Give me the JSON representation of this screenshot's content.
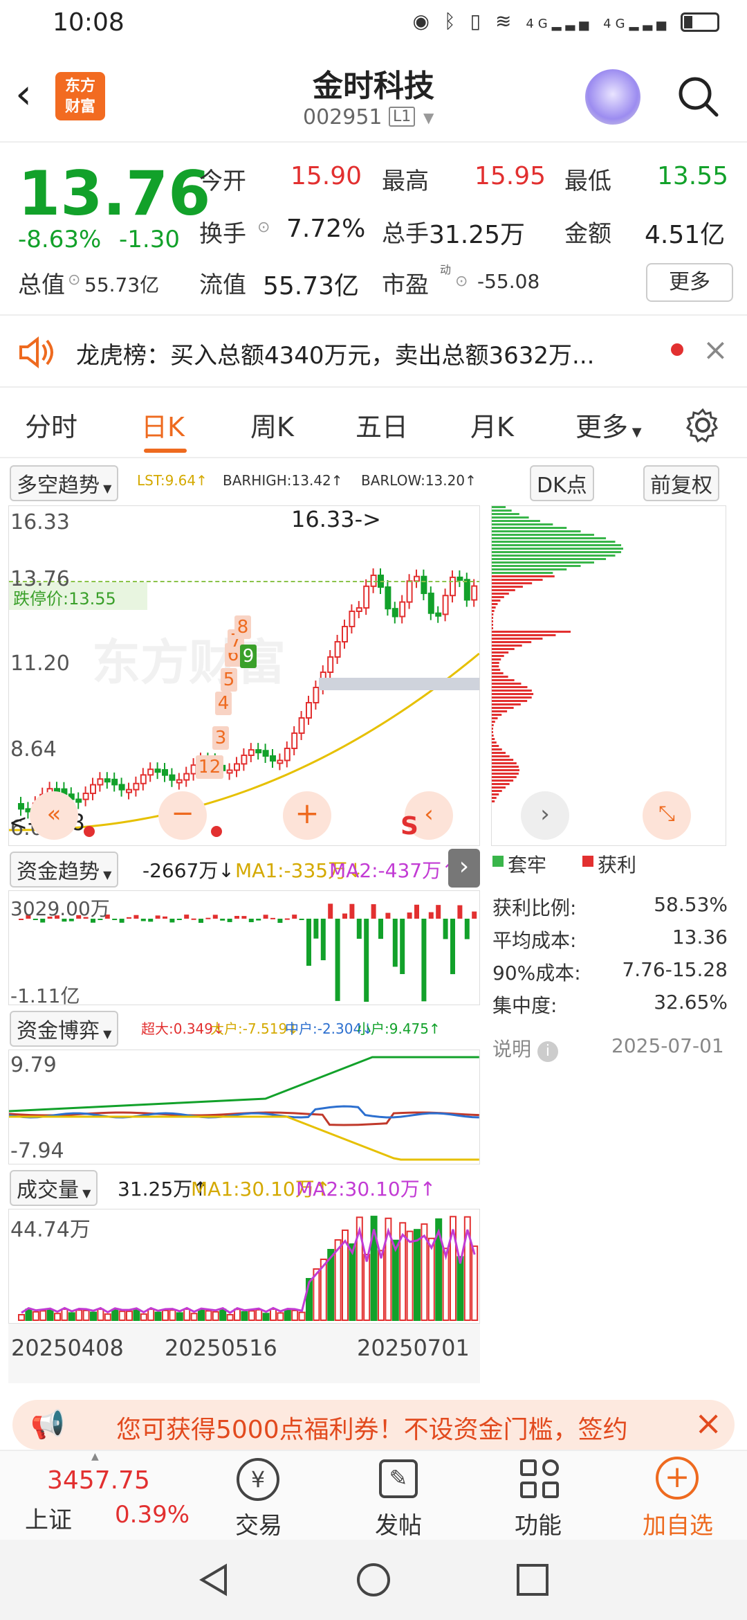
{
  "status": {
    "time": "10:08",
    "network1": "4G",
    "network2": "4G"
  },
  "header": {
    "logo_text": "东方\n财富",
    "title": "金时科技",
    "code": "002951",
    "level": "L1"
  },
  "quote": {
    "price": "13.76",
    "change_pct": "-8.63%",
    "change": "-1.30",
    "open_label": "今开",
    "open": "15.90",
    "high_label": "最高",
    "high": "15.95",
    "low_label": "最低",
    "low": "13.55",
    "turnover_label": "换手",
    "turnover": "7.72%",
    "volume_label": "总手",
    "volume": "31.25万",
    "amount_label": "金额",
    "amount": "4.51亿",
    "mktcap_label": "总值",
    "mktcap": "55.73亿",
    "float_label": "流值",
    "float": "55.73亿",
    "pe_label": "市盈",
    "pe_sup": "动",
    "pe": "-55.08",
    "more": "更多"
  },
  "notice": {
    "text": "龙虎榜：买入总额4340万元，卖出总额3632万..."
  },
  "tabs": [
    "分时",
    "日K",
    "周K",
    "五日",
    "月K",
    "更多"
  ],
  "kline": {
    "indicator": "多空趋势",
    "lst": "LST:9.64↑",
    "barhigh": "BARHIGH:13.42↑",
    "barlow": "BARLOW:13.20↑",
    "dk_btn": "DK点",
    "fq_btn": "前复权",
    "y_labels": [
      "16.33",
      "13.76",
      "11.20",
      "8.64",
      "6.08"
    ],
    "high_mark": "16.33->",
    "low_mark": "<-6.08",
    "limit_label": "跌停价:13.55",
    "seq_nums": [
      "1",
      "2",
      "3",
      "4",
      "5",
      "6",
      "7",
      "8",
      "9"
    ],
    "watermark": "东方财富"
  },
  "fund": {
    "label": "资金趋势",
    "val": "-2667万↓",
    "ma1": "MA1:-335万↓",
    "ma2": "MA2:-437万↑",
    "top": "3029.00万",
    "bottom": "-1.11亿"
  },
  "game": {
    "label": "资金博弈",
    "super": "超大:0.349↓",
    "big": "大户:-7.519↓",
    "mid": "中户:-2.304↓",
    "small": "小户:9.475↑",
    "top": "9.79",
    "bottom": "-7.94"
  },
  "vol": {
    "label": "成交量",
    "val": "31.25万↑",
    "ma1": "MA1:30.10万↑",
    "ma2": "MA2:30.10万↑",
    "top": "44.74万"
  },
  "dates": [
    "20250408",
    "20250516",
    "20250701"
  ],
  "chip": {
    "legend_trap": "套牢",
    "legend_profit": "获利",
    "rows": [
      {
        "k": "获利比例:",
        "v": "58.53%"
      },
      {
        "k": "平均成本:",
        "v": "13.36"
      },
      {
        "k": "90%成本:",
        "v": "7.76-15.28"
      },
      {
        "k": "集中度:",
        "v": "32.65%"
      }
    ],
    "note": "说明",
    "date": "2025-07-01"
  },
  "banner": {
    "text": "您可获得5000点福利券！不设资金门槛，签约"
  },
  "bottom": {
    "index_value": "3457.75",
    "index_name": "上证",
    "index_pct": "0.39%",
    "trade": "交易",
    "post": "发帖",
    "func": "功能",
    "add": "加自选"
  },
  "colors": {
    "up": "#e23030",
    "down": "#12a12a",
    "accent": "#ee6a1f"
  }
}
